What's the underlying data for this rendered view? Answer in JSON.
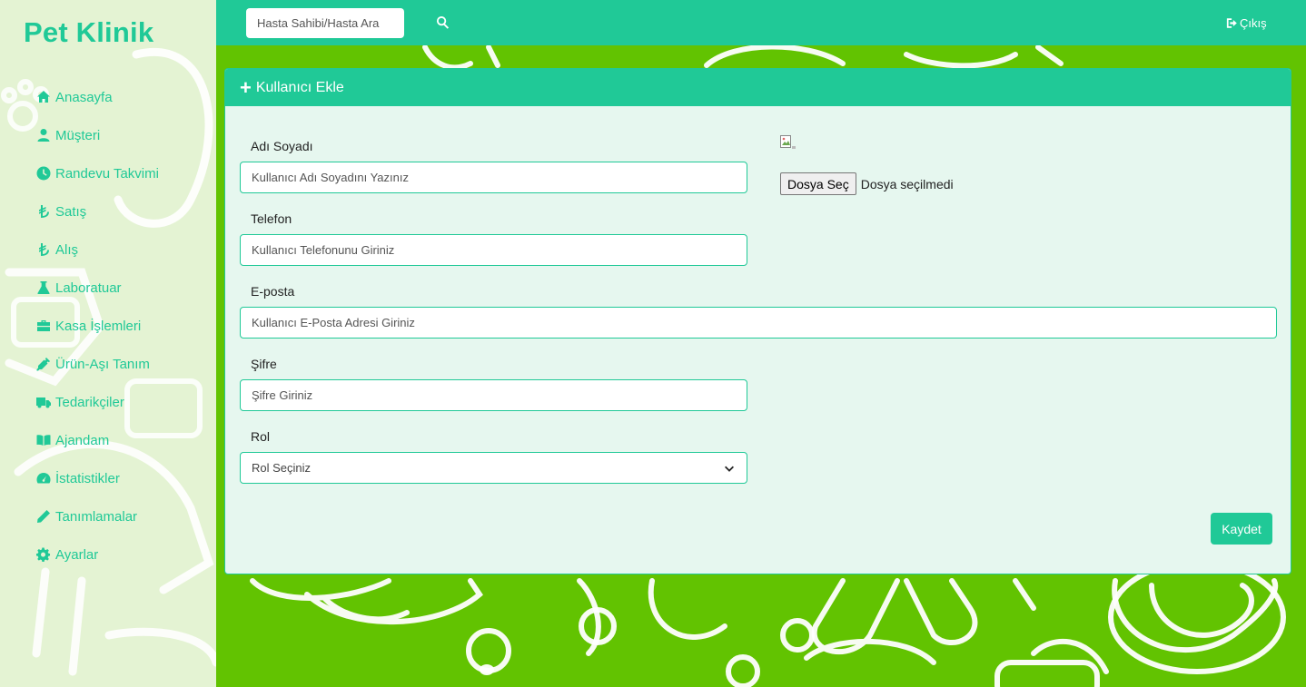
{
  "sidebar": {
    "brand": "Pet Klinik",
    "items": [
      {
        "label": "Anasayfa",
        "icon": "home-icon"
      },
      {
        "label": "Müşteri",
        "icon": "user-icon"
      },
      {
        "label": "Randevu Takvimi",
        "icon": "clock-icon"
      },
      {
        "label": "Satış",
        "icon": "lira-icon"
      },
      {
        "label": "Alış",
        "icon": "lira-icon"
      },
      {
        "label": "Laboratuar",
        "icon": "flask-icon"
      },
      {
        "label": "Kasa İşlemleri",
        "icon": "briefcase-icon"
      },
      {
        "label": "Ürün-Aşı Tanım",
        "icon": "syringe-icon"
      },
      {
        "label": "Tedarikçiler",
        "icon": "truck-icon"
      },
      {
        "label": "Ajandam",
        "icon": "book-icon"
      },
      {
        "label": "İstatistikler",
        "icon": "gauge-icon"
      },
      {
        "label": "Tanımlamalar",
        "icon": "pencil-icon"
      },
      {
        "label": "Ayarlar",
        "icon": "gear-icon"
      }
    ]
  },
  "topbar": {
    "search_placeholder": "Hasta Sahibi/Hasta Ara",
    "logout_label": "Çıkış"
  },
  "card": {
    "title": "Kullanıcı Ekle",
    "fields": {
      "name": {
        "label": "Adı Soyadı",
        "placeholder": "Kullanıcı Adı Soyadını Yazınız"
      },
      "phone": {
        "label": "Telefon",
        "placeholder": "Kullanıcı Telefonunu Giriniz"
      },
      "email": {
        "label": "E-posta",
        "placeholder": "Kullanıcı E-Posta Adresi Giriniz"
      },
      "password": {
        "label": "Şifre",
        "placeholder": "Şifre Giriniz"
      },
      "role": {
        "label": "Rol",
        "selected": "Rol Seçiniz"
      }
    },
    "file": {
      "button_label": "Dosya Seç",
      "status": "Dosya seçilmedi"
    },
    "save_label": "Kaydet"
  },
  "colors": {
    "accent": "#20c997",
    "background_green": "#62c301",
    "sidebar_bg": "#e4f3d3",
    "card_bg": "#e6f7ef"
  }
}
